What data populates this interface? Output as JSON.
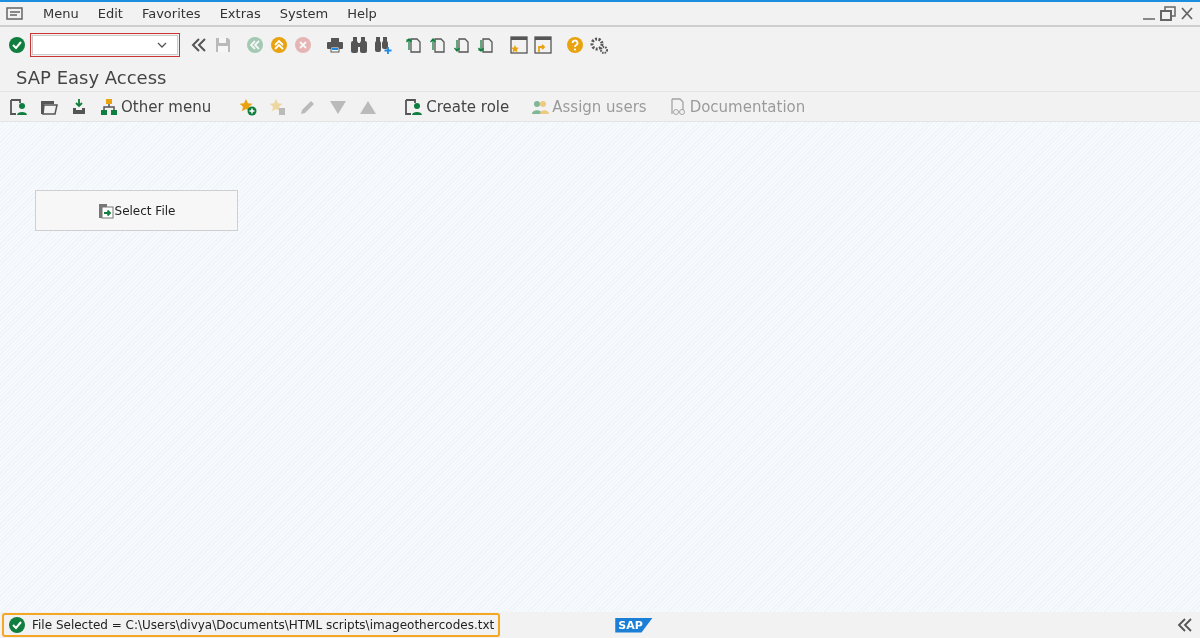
{
  "menu_bar": {
    "items": [
      {
        "label": "Menu"
      },
      {
        "label": "Edit"
      },
      {
        "label": "Favorites"
      },
      {
        "label": "Extras"
      },
      {
        "label": "System"
      },
      {
        "label": "Help"
      }
    ]
  },
  "system_toolbar": {
    "buttons": [
      {
        "kind": "enter",
        "disabled": false
      },
      {
        "kind": "collapse",
        "disabled": false
      },
      {
        "kind": "save",
        "disabled": true
      },
      {
        "kind": "back",
        "disabled": true
      },
      {
        "kind": "exit",
        "disabled": false
      },
      {
        "kind": "cancel",
        "disabled": true
      },
      {
        "kind": "print",
        "disabled": false
      },
      {
        "kind": "find",
        "disabled": false
      },
      {
        "kind": "find-next",
        "disabled": false
      },
      {
        "kind": "first-page",
        "disabled": false
      },
      {
        "kind": "previous-page",
        "disabled": false
      },
      {
        "kind": "next-page",
        "disabled": false
      },
      {
        "kind": "last-page",
        "disabled": false
      },
      {
        "kind": "new-session",
        "disabled": false
      },
      {
        "kind": "shortcut",
        "disabled": false
      },
      {
        "kind": "help",
        "disabled": false
      },
      {
        "kind": "settings",
        "disabled": false
      }
    ]
  },
  "title": "SAP Easy Access",
  "application_toolbar": [
    {
      "kind": "user-menu",
      "disabled": false
    },
    {
      "kind": "sap-menu",
      "disabled": false
    },
    {
      "kind": "business-workplace",
      "disabled": false
    },
    {
      "kind": "other-menu",
      "label": "Other menu",
      "disabled": false
    },
    {
      "kind": "add-favorite",
      "disabled": false
    },
    {
      "kind": "delete-favorite",
      "disabled": true
    },
    {
      "kind": "edit",
      "disabled": true
    },
    {
      "kind": "move-down",
      "disabled": true
    },
    {
      "kind": "move-up",
      "disabled": true
    },
    {
      "kind": "create-role",
      "label": "Create role",
      "disabled": false
    },
    {
      "kind": "assign-users",
      "label": "Assign users",
      "disabled": true
    },
    {
      "kind": "documentation",
      "label": "Documentation",
      "disabled": true
    }
  ],
  "content": {
    "button": {
      "label": "Select File"
    }
  },
  "status_bar": {
    "kind": "success",
    "message": "File Selected = C:\\Users\\divya\\Documents\\HTML scripts\\imageothercodes.txt",
    "highlighted": true,
    "logo": "SAP"
  }
}
